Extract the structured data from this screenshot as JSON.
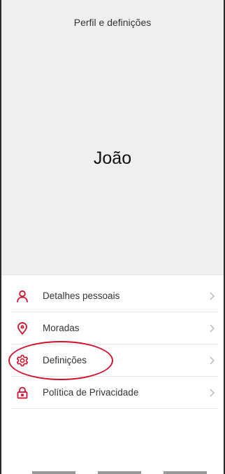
{
  "header": {
    "title": "Perfil e definições",
    "profile_name": "João"
  },
  "menu": {
    "items": [
      {
        "label": "Detalhes pessoais",
        "icon": "person-icon"
      },
      {
        "label": "Moradas",
        "icon": "location-pin-icon"
      },
      {
        "label": "Definições",
        "icon": "gear-icon"
      },
      {
        "label": "Política de Privacidade",
        "icon": "lock-icon"
      }
    ]
  },
  "colors": {
    "accent": "#d0112b",
    "header_background": "#efefef",
    "chevron": "#b5b5b5"
  }
}
